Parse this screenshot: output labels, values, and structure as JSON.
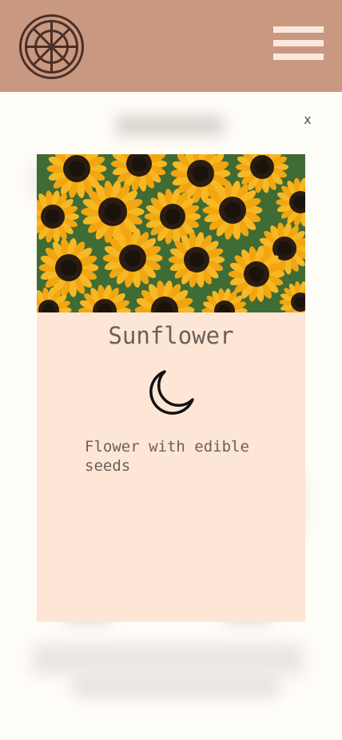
{
  "header": {
    "logo_icon": "ships-wheel-icon",
    "menu_icon": "hamburger-menu-icon",
    "background_color": "#c99880"
  },
  "modal": {
    "close_label": "x",
    "photo_icon": "sunflower-photo",
    "title": "Sunflower",
    "status_icon": "moon-icon",
    "description": "Flower with edible seeds",
    "background_color": "#fde6d6"
  }
}
